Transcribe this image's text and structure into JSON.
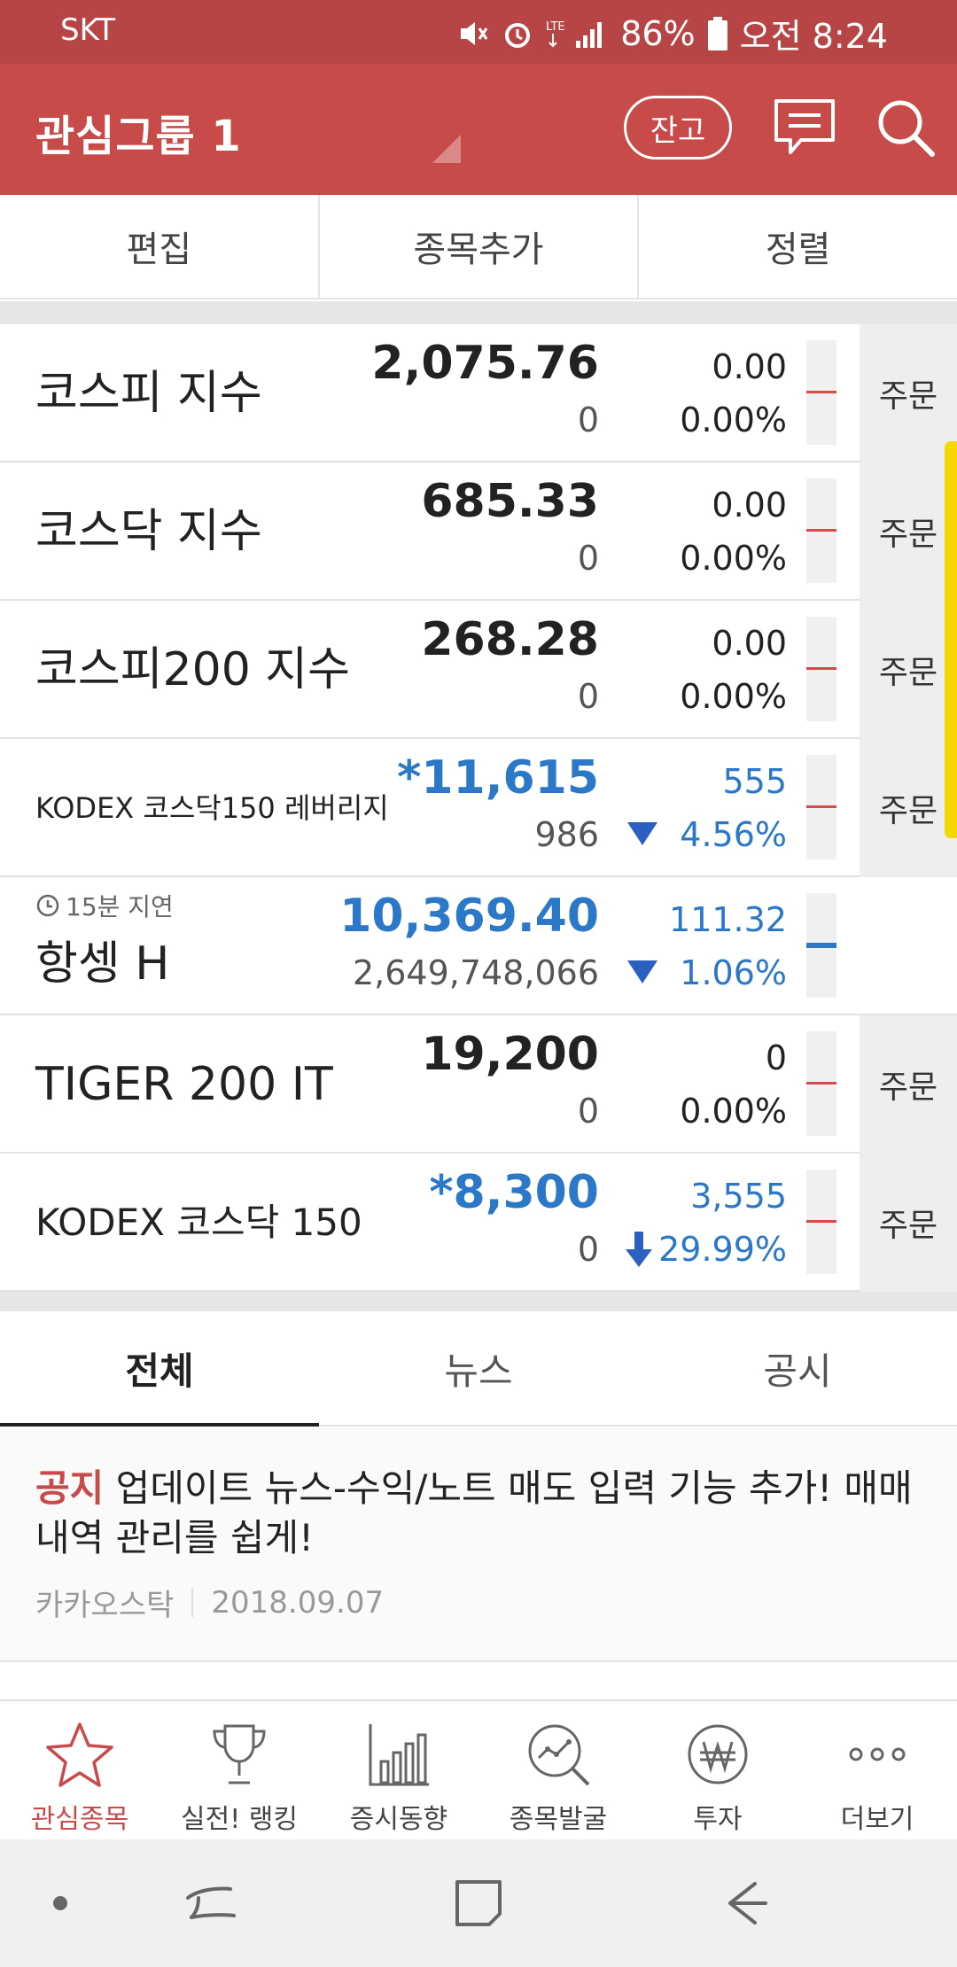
{
  "status_bar": {
    "carrier": "SKT",
    "battery": "86%",
    "time": "오전 8:24"
  },
  "header": {
    "title": "관심그룹 1",
    "balance_button": "잔고"
  },
  "actions": {
    "edit": "편집",
    "add_stock": "종목추가",
    "sort": "정렬"
  },
  "stocks": [
    {
      "name": "코스피 지수",
      "price": "2,075.76",
      "volume": "0",
      "change": "0.00",
      "pct": "0.00%",
      "order": "주문"
    },
    {
      "name": "코스닥 지수",
      "price": "685.33",
      "volume": "0",
      "change": "0.00",
      "pct": "0.00%",
      "order": "주문"
    },
    {
      "name": "코스피200 지수",
      "price": "268.28",
      "volume": "0",
      "change": "0.00",
      "pct": "0.00%",
      "order": "주문"
    },
    {
      "name": "KODEX 코스닥150 레버리지",
      "price": "*11,615",
      "volume": "986",
      "change": "555",
      "pct": "4.56%",
      "order": "주문"
    },
    {
      "name": "항셍 H",
      "delay": "15분 지연",
      "price": "10,369.40",
      "volume": "2,649,748,066",
      "change": "111.32",
      "pct": "1.06%"
    },
    {
      "name": "TIGER 200 IT",
      "price": "19,200",
      "volume": "0",
      "change": "0",
      "pct": "0.00%",
      "order": "주문"
    },
    {
      "name": "KODEX 코스닥 150",
      "price": "*8,300",
      "volume": "0",
      "change": "3,555",
      "pct": "29.99%",
      "order": "주문"
    }
  ],
  "news_tabs": [
    "전체",
    "뉴스",
    "공시"
  ],
  "news": {
    "tag": "공지",
    "headline": "업데이트 뉴스-수익/노트 매도 입력 기능 추가! 매매내역 관리를 쉽게!",
    "source": "카카오스탁",
    "date": "2018.09.07"
  },
  "bottom_nav": [
    "관심종목",
    "실전! 랭킹",
    "증시동향",
    "종목발굴",
    "투자",
    "더보기"
  ],
  "colors": {
    "brand": "#c64b49",
    "down_blue": "#2b78c8",
    "neutral_red": "#d84a4a",
    "scroll_yellow": "#f5d800"
  }
}
